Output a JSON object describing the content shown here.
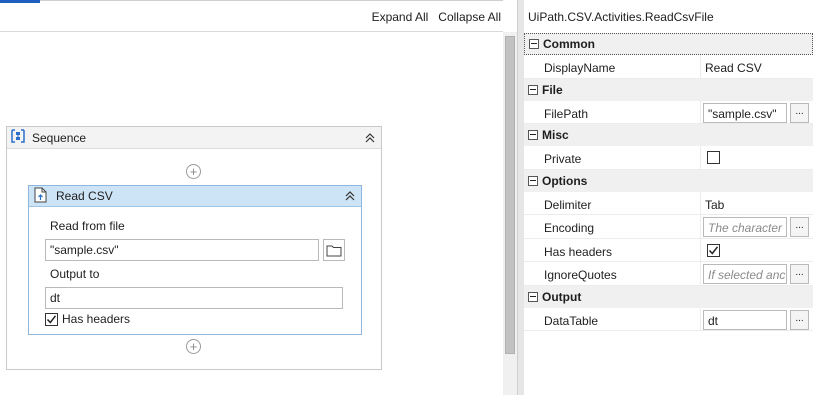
{
  "toolbar": {
    "expand_all": "Expand All",
    "collapse_all": "Collapse All"
  },
  "sequence": {
    "title": "Sequence",
    "activity": {
      "title": "Read CSV",
      "read_from_label": "Read from file",
      "file_value": "\"sample.csv\"",
      "output_label": "Output to",
      "output_value": "dt",
      "has_headers_label": "Has headers",
      "has_headers_checked": true
    }
  },
  "properties": {
    "title": "UiPath.CSV.Activities.ReadCsvFile",
    "categories": [
      {
        "name": "Common",
        "rows": [
          {
            "name": "DisplayName",
            "value": "Read CSV"
          }
        ]
      },
      {
        "name": "File",
        "rows": [
          {
            "name": "FilePath",
            "value": "\"sample.csv\""
          }
        ]
      },
      {
        "name": "Misc",
        "rows": [
          {
            "name": "Private",
            "checked": false
          }
        ]
      },
      {
        "name": "Options",
        "rows": [
          {
            "name": "Delimiter",
            "value": "Tab"
          },
          {
            "name": "Encoding",
            "placeholder": "The character"
          },
          {
            "name": "Has headers",
            "checked": true
          },
          {
            "name": "IgnoreQuotes",
            "placeholder": "If selected anc"
          }
        ]
      },
      {
        "name": "Output",
        "rows": [
          {
            "name": "DataTable",
            "value": "dt"
          }
        ]
      }
    ],
    "ellipsis": "..."
  },
  "colors": {
    "accent": "#1f5fbf",
    "activity_header": "#cde3f6",
    "category_bg": "#f0f0f0"
  }
}
